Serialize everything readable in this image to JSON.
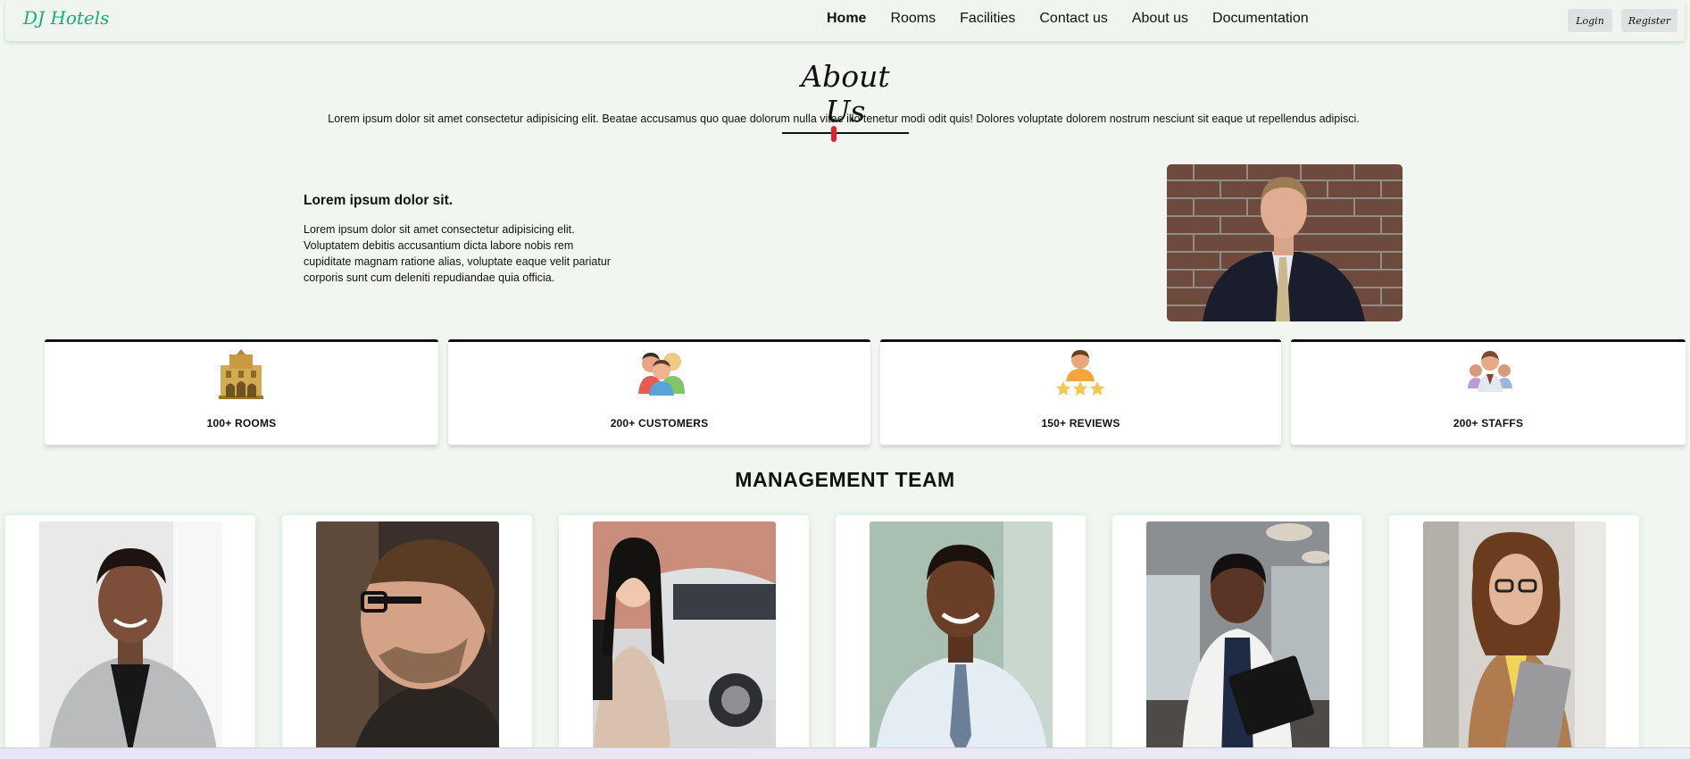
{
  "navbar": {
    "brand": "DJ Hotels",
    "links": [
      "Home",
      "Rooms",
      "Facilities",
      "Contact us",
      "About us",
      "Documentation"
    ],
    "login_label": "Login",
    "register_label": "Register"
  },
  "about": {
    "title": "About Us",
    "intro": "Lorem ipsum dolor sit amet consectetur adipisicing elit. Beatae accusamus quo quae dolorum nulla vitae illo tenetur modi odit quis! Dolores voluptate dolorem nostrum nesciunt sit eaque ut repellendus adipisci.",
    "subtitle": "Lorem ipsum dolor sit.",
    "text": "Lorem ipsum dolor sit amet consectetur adipisicing elit. Voluptatem debitis accusantium dicta labore nobis rem cupiditate magnam ratione alias, voluptate eaque velit pariatur corporis sunt cum deleniti repudiandae quia officia."
  },
  "stats": [
    {
      "label": "100+ ROOMS",
      "icon": "hotel-icon"
    },
    {
      "label": "200+ CUSTOMERS",
      "icon": "customers-icon"
    },
    {
      "label": "150+ REVIEWS",
      "icon": "reviews-icon"
    },
    {
      "label": "200+ STAFFS",
      "icon": "staff-icon"
    }
  ],
  "team": {
    "title": "MANAGEMENT TEAM",
    "members": [
      {
        "photo": "woman-grey-blazer-photo"
      },
      {
        "photo": "man-glasses-profile-photo"
      },
      {
        "photo": "woman-car-folder-photo"
      },
      {
        "photo": "woman-shirt-tie-photo"
      },
      {
        "photo": "woman-binders-office-photo"
      },
      {
        "photo": "woman-curly-hair-laptop-photo"
      }
    ]
  },
  "colors": {
    "brand": "#15b07c",
    "background": "#f2f6f1",
    "cursor_marker": "#e0202a"
  }
}
